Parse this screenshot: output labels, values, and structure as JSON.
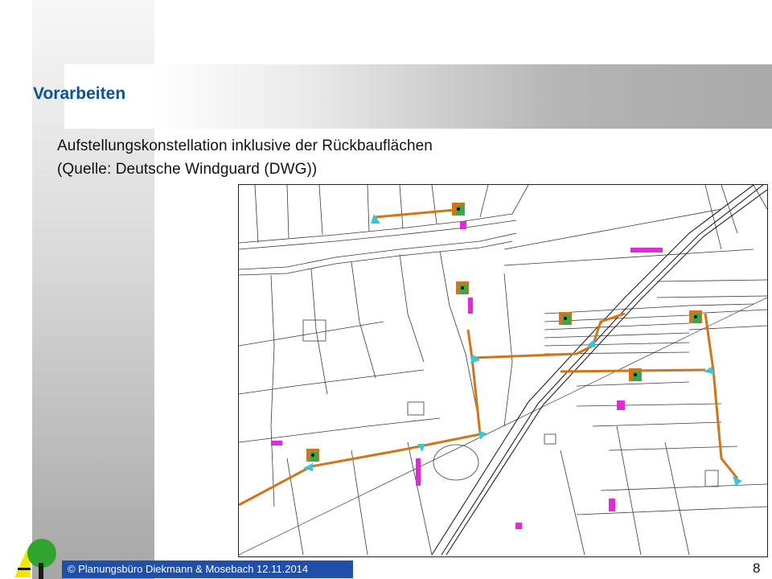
{
  "slide": {
    "title": "Vorarbeiten",
    "subtitle_line1": "Aufstellungskonstellation inklusive der Rückbauflächen",
    "subtitle_line2": "(Quelle: Deutsche Windguard (DWG))",
    "page_number": "8"
  },
  "footer": {
    "text": "© Planungsbüro Diekmann & Mosebach 12.11.2014"
  },
  "map": {
    "turbine_count": 6,
    "colors": {
      "road": "#d4731a",
      "turn_area": "#39c6d6",
      "removal_area": "#e02ad8",
      "foundation": "#3aa84a",
      "crane_pad": "#d4731a"
    }
  },
  "colors": {
    "title": "#0b5394",
    "footer_bg": "#1f4fa8",
    "footer_text": "#ffffff"
  }
}
